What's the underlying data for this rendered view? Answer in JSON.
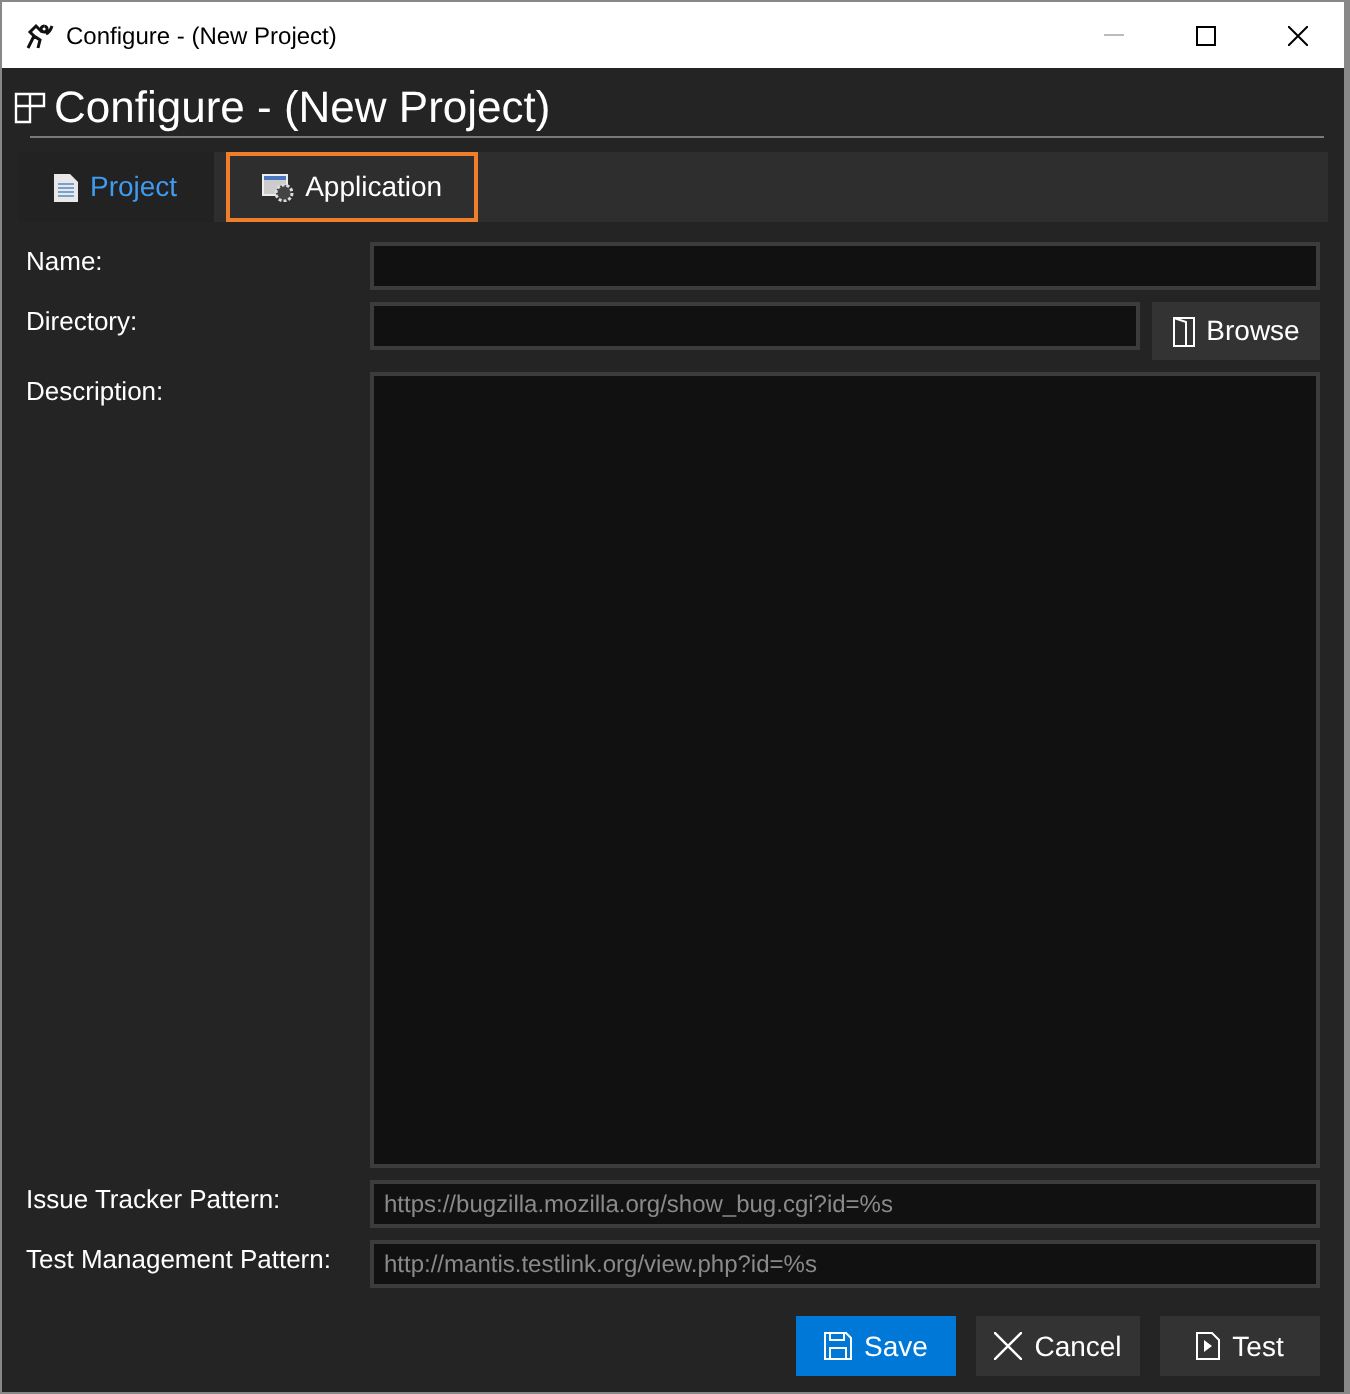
{
  "window": {
    "title": "Configure - (New Project)"
  },
  "header": {
    "title": "Configure - (New Project)"
  },
  "tabs": [
    {
      "label": "Project",
      "selected": true,
      "focused": false
    },
    {
      "label": "Application",
      "selected": false,
      "focused": true
    }
  ],
  "form": {
    "name_label": "Name:",
    "directory_label": "Directory:",
    "browse_button": "Browse",
    "description_label": "Description:",
    "issue_tracker_label": "Issue Tracker Pattern:",
    "issue_tracker_placeholder": "https://bugzilla.mozilla.org/show_bug.cgi?id=%s",
    "test_management_label": "Test Management Pattern:",
    "test_management_placeholder": "http://mantis.testlink.org/view.php?id=%s"
  },
  "buttons": [
    {
      "label": "Save",
      "kind": "save"
    },
    {
      "label": "Cancel",
      "kind": "cancel"
    },
    {
      "label": "Test",
      "kind": "test"
    }
  ]
}
